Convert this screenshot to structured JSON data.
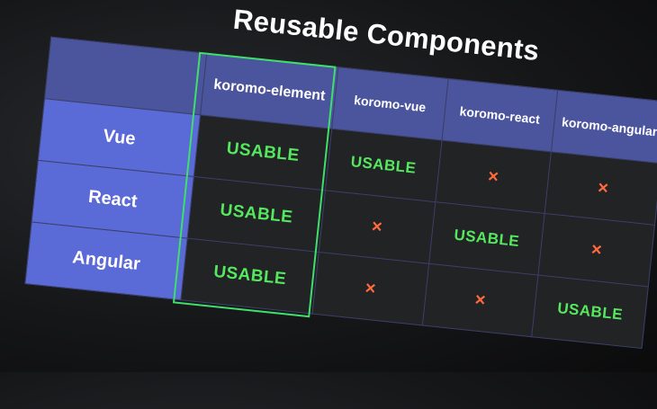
{
  "slide": {
    "title": "Reusable Components"
  },
  "table": {
    "columns": [
      "koromo-element",
      "koromo-vue",
      "koromo-react",
      "koromo-angular"
    ],
    "rows": [
      {
        "label": "Vue",
        "cells": [
          "USABLE",
          "USABLE",
          "×",
          "×"
        ]
      },
      {
        "label": "React",
        "cells": [
          "USABLE",
          "×",
          "USABLE",
          "×"
        ]
      },
      {
        "label": "Angular",
        "cells": [
          "USABLE",
          "×",
          "×",
          "USABLE"
        ]
      }
    ],
    "highlighted_column": "koromo-element"
  },
  "colors": {
    "header_bg": "#4a559e",
    "row_header_bg": "#5a6ad6",
    "usable": "#55e85f",
    "cross": "#ff6a3d",
    "highlight_border": "#3fe06a"
  }
}
